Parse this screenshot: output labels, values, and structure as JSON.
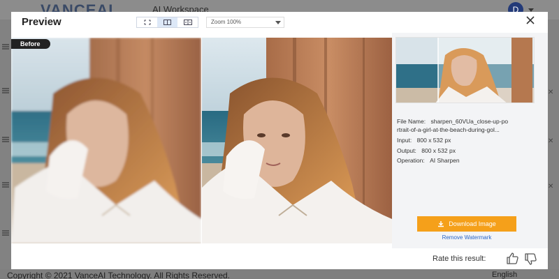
{
  "app": {
    "logo": "VANCEAI",
    "workspace_label": "AI Workspace",
    "avatar_initial": "D",
    "footer_copyright": "Copyright © 2021 VanceAI Technology. All Rights Reserved.",
    "footer_language": "English"
  },
  "modal": {
    "title": "Preview",
    "zoom_label": "Zoom  100%",
    "before_badge": "Before",
    "info": {
      "file_name_label": "File Name:",
      "file_name_value_1": "sharpen_60VUa_close-up-po",
      "file_name_value_2": "rtrait-of-a-girl-at-the-beach-during-gol...",
      "input_label": "Input:",
      "input_value": "800 x 532 px",
      "output_label": "Output:",
      "output_value": "800 x 532 px",
      "operation_label": "Operation:",
      "operation_value": "AI Sharpen"
    },
    "download_label": "Download Image",
    "remove_watermark_label": "Remove Watermark",
    "rate_label": "Rate this result:"
  },
  "colors": {
    "accent_orange": "#f5a01a",
    "link_blue": "#2a66c8",
    "logo_navy": "#3a4a66"
  }
}
